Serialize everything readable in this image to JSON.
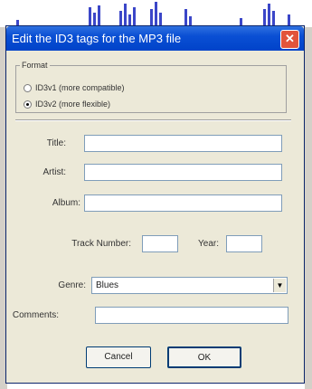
{
  "dialog": {
    "title": "Edit the ID3 tags for the MP3 file",
    "close_glyph": "✕",
    "colors": {
      "titlebar": "#0a4fd4",
      "close": "#e2543b",
      "face": "#ece9d8",
      "waveform": "#3b46c8"
    }
  },
  "format": {
    "legend": "Format",
    "options": [
      {
        "label": "ID3v1 (more compatible)",
        "selected": false
      },
      {
        "label": "ID3v2 (more flexible)",
        "selected": true
      }
    ]
  },
  "fields": {
    "title": {
      "label": "Title:",
      "value": ""
    },
    "artist": {
      "label": "Artist:",
      "value": ""
    },
    "album": {
      "label": "Album:",
      "value": ""
    },
    "track_number": {
      "label": "Track Number:",
      "value": ""
    },
    "year": {
      "label": "Year:",
      "value": ""
    },
    "genre": {
      "label": "Genre:",
      "value": "Blues"
    },
    "comments": {
      "label": "Comments:",
      "value": ""
    }
  },
  "buttons": {
    "cancel": "Cancel",
    "ok": "OK"
  },
  "icons": {
    "close": "close-icon",
    "dropdown": "chevron-down-icon"
  }
}
